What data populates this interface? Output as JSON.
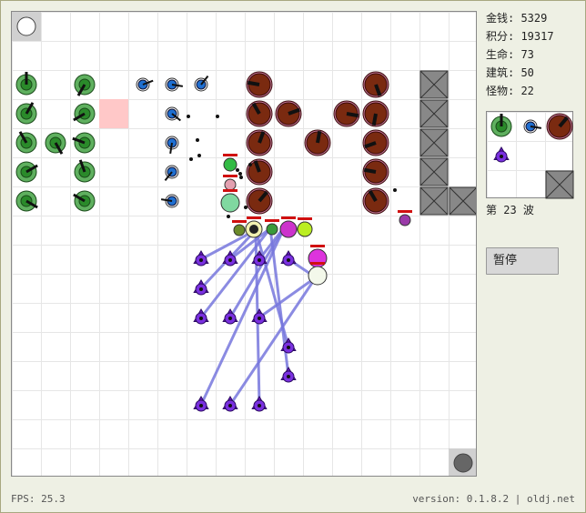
{
  "stats": {
    "money": "金钱: 5329",
    "score": "积分: 19317",
    "life": "生命: 73",
    "buildings": "建筑: 50",
    "monsters": "怪物: 22"
  },
  "wave": "第 23 波",
  "pause_label": "暂停",
  "fps": "FPS: 25.3",
  "version": "version: 0.1.8.2 | oldj.net",
  "colors": {
    "green_tower": "#2a8a2a",
    "blue_tower": "#1f6fd0",
    "brown_tower": "#7a2a10",
    "wall": "#888888",
    "monster": "#6a18c0",
    "laser": "#7777dd",
    "highlight_cell": "#ffc8c8",
    "health_bar": "#d01010"
  },
  "icons": [
    "start-circle-icon",
    "exit-circle-icon",
    "cannon-tower-icon",
    "laser-tower-icon",
    "heavy-tower-icon",
    "wall-block-icon",
    "monster-icon"
  ],
  "board": {
    "towers": [
      {
        "type": "green",
        "col": 0,
        "row": 2
      },
      {
        "type": "green",
        "col": 0,
        "row": 3
      },
      {
        "type": "green",
        "col": 0,
        "row": 4
      },
      {
        "type": "green",
        "col": 0,
        "row": 5
      },
      {
        "type": "green",
        "col": 0,
        "row": 6
      },
      {
        "type": "green",
        "col": 1,
        "row": 4
      },
      {
        "type": "green",
        "col": 2,
        "row": 2
      },
      {
        "type": "green",
        "col": 2,
        "row": 3
      },
      {
        "type": "green",
        "col": 2,
        "row": 4
      },
      {
        "type": "green",
        "col": 2,
        "row": 5
      },
      {
        "type": "green",
        "col": 2,
        "row": 6
      },
      {
        "type": "blue",
        "col": 4,
        "row": 2
      },
      {
        "type": "blue",
        "col": 5,
        "row": 2
      },
      {
        "type": "blue",
        "col": 6,
        "row": 2
      },
      {
        "type": "blue",
        "col": 5,
        "row": 3
      },
      {
        "type": "blue",
        "col": 5,
        "row": 4
      },
      {
        "type": "blue",
        "col": 5,
        "row": 5
      },
      {
        "type": "blue",
        "col": 5,
        "row": 6
      },
      {
        "type": "brown",
        "col": 8,
        "row": 2
      },
      {
        "type": "brown",
        "col": 8,
        "row": 3
      },
      {
        "type": "brown",
        "col": 8,
        "row": 4
      },
      {
        "type": "brown",
        "col": 8,
        "row": 5
      },
      {
        "type": "brown",
        "col": 8,
        "row": 6
      },
      {
        "type": "brown",
        "col": 9,
        "row": 3
      },
      {
        "type": "brown",
        "col": 10,
        "row": 4
      },
      {
        "type": "brown",
        "col": 11,
        "row": 3
      },
      {
        "type": "brown",
        "col": 12,
        "row": 2
      },
      {
        "type": "brown",
        "col": 12,
        "row": 3
      },
      {
        "type": "brown",
        "col": 12,
        "row": 4
      },
      {
        "type": "brown",
        "col": 12,
        "row": 5
      },
      {
        "type": "brown",
        "col": 12,
        "row": 6
      }
    ],
    "walls": [
      {
        "col": 14,
        "row": 2
      },
      {
        "col": 14,
        "row": 3
      },
      {
        "col": 14,
        "row": 4
      },
      {
        "col": 14,
        "row": 5
      },
      {
        "col": 14,
        "row": 6
      },
      {
        "col": 15,
        "row": 6
      }
    ],
    "highlight": {
      "col": 3,
      "row": 3
    },
    "monsters": [
      {
        "col": 6,
        "row": 8
      },
      {
        "col": 7,
        "row": 8
      },
      {
        "col": 8,
        "row": 8
      },
      {
        "col": 9,
        "row": 8
      },
      {
        "col": 6,
        "row": 9
      },
      {
        "col": 6,
        "row": 10
      },
      {
        "col": 7,
        "row": 10
      },
      {
        "col": 8,
        "row": 10
      },
      {
        "col": 9,
        "row": 11
      },
      {
        "col": 9,
        "row": 12
      },
      {
        "col": 6,
        "row": 13
      },
      {
        "col": 7,
        "row": 13
      },
      {
        "col": 8,
        "row": 13
      }
    ]
  },
  "minimap": {
    "tools": [
      "cannon-tower",
      "laser-tower",
      "heavy-tower",
      "monster",
      "wall"
    ]
  }
}
